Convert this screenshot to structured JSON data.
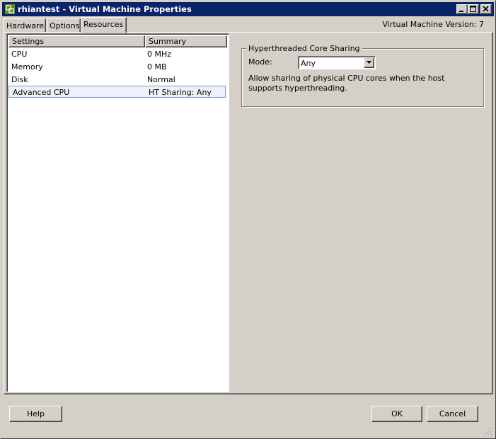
{
  "window": {
    "title": "rhiantest - Virtual Machine Properties",
    "app_icon": "vm-icon",
    "controls": [
      "minimize",
      "maximize",
      "close"
    ]
  },
  "tabs": [
    {
      "label": "Hardware",
      "active": false
    },
    {
      "label": "Options",
      "active": false
    },
    {
      "label": "Resources",
      "active": true
    }
  ],
  "vm_version": "Virtual Machine Version: 7",
  "settings_list": {
    "headers": [
      "Settings",
      "Summary"
    ],
    "rows": [
      {
        "setting": "CPU",
        "summary": "0 MHz"
      },
      {
        "setting": "Memory",
        "summary": "0 MB"
      },
      {
        "setting": "Disk",
        "summary": "Normal"
      },
      {
        "setting": "Advanced CPU",
        "summary": "HT Sharing: Any",
        "selected": true
      }
    ]
  },
  "ht_sharing": {
    "group_title": "Hyperthreaded Core Sharing",
    "mode_label": "Mode:",
    "mode_value": "Any",
    "description": "Allow sharing of physical CPU cores when the host supports hyperthreading."
  },
  "buttons": {
    "help": "Help",
    "ok": "OK",
    "cancel": "Cancel"
  },
  "colors": {
    "titlebar": "#0a246a",
    "dialog_bg": "#d4d0c8",
    "selection_border": "#7a96c6"
  }
}
